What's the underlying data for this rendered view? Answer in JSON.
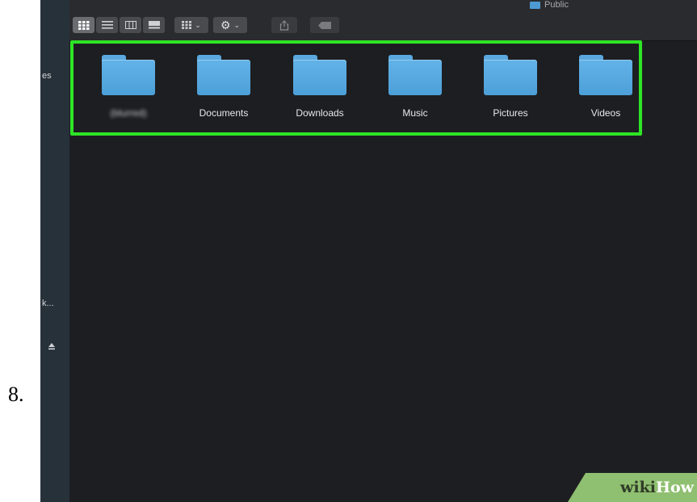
{
  "step": {
    "number": "8."
  },
  "sidebar": {
    "fragments": [
      {
        "text": "es"
      },
      {
        "text": "k..."
      }
    ],
    "eject_icon": "eject-icon"
  },
  "toolbar": {
    "view_buttons": [
      {
        "icon": "icon-view-icon",
        "active": true
      },
      {
        "icon": "list-view-icon",
        "active": false
      },
      {
        "icon": "column-view-icon",
        "active": false
      },
      {
        "icon": "gallery-view-icon",
        "active": false
      }
    ],
    "group_icon": "group-by-icon",
    "action_icon": "gear-icon",
    "share_icon": "share-icon",
    "tag_icon": "tag-icon",
    "path_crumb": "Public"
  },
  "folders": [
    {
      "name": "(blurred)",
      "blurred": true
    },
    {
      "name": "Documents",
      "blurred": false
    },
    {
      "name": "Downloads",
      "blurred": false
    },
    {
      "name": "Music",
      "blurred": false
    },
    {
      "name": "Pictures",
      "blurred": false
    },
    {
      "name": "Videos",
      "blurred": false
    }
  ],
  "colors": {
    "highlight": "#2ee526",
    "folder": "#5aa8df",
    "window_bg": "#1d1e21"
  },
  "watermark": {
    "part1": "wiki",
    "part2": "How"
  }
}
